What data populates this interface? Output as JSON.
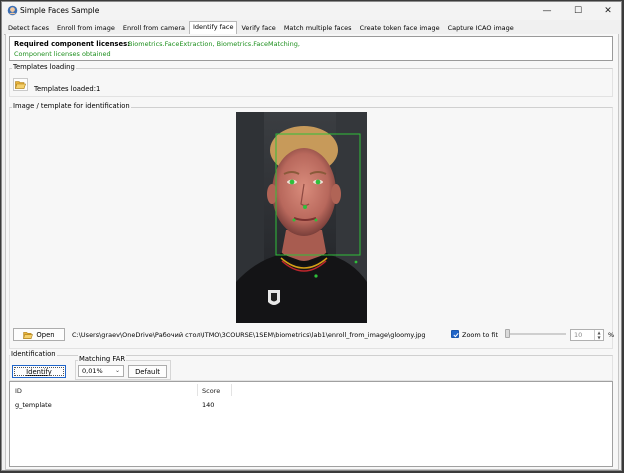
{
  "window": {
    "title": "Simple Faces Sample",
    "controls": {
      "minimize": "—",
      "maximize": "☐",
      "close": "✕"
    }
  },
  "tabs": [
    {
      "label": "Detect faces",
      "active": false
    },
    {
      "label": "Enroll from image",
      "active": false
    },
    {
      "label": "Enroll from camera",
      "active": false
    },
    {
      "label": "Identify face",
      "active": true
    },
    {
      "label": "Verify face",
      "active": false
    },
    {
      "label": "Match multiple faces",
      "active": false
    },
    {
      "label": "Create token face image",
      "active": false
    },
    {
      "label": "Capture ICAO image",
      "active": false
    }
  ],
  "licenses": {
    "label": "Required component licenses:",
    "list": "Biometrics.FaceExtraction, Biometrics.FaceMatching,",
    "status": "Component licenses obtained",
    "status_color": "#1d8f1d"
  },
  "templates": {
    "group_title": "Templates loading",
    "loaded_label": "Templates loaded:",
    "loaded_count": "1",
    "open_icon": "folder-open-icon"
  },
  "image_group": {
    "title": "Image / template for identification",
    "open_label": "Open",
    "file_path": "C:\\Users\\graev\\OneDrive\\Рабочий стол\\ITMO\\3COURSE\\1SEM\\biometrics\\lab1\\enroll_from_image\\gloomy.jpg",
    "zoom_to_fit_label": "Zoom to fit",
    "zoom_to_fit_checked": true,
    "zoom_value": "10",
    "percent_sign": "%"
  },
  "identification": {
    "group_title": "Identification",
    "identify_label": "Identify",
    "matching_far_title": "Matching FAR",
    "far_value": "0,01%",
    "default_label": "Default"
  },
  "results": {
    "columns": [
      "ID",
      "Score"
    ],
    "rows": [
      {
        "id": "g_template",
        "score": "140"
      }
    ]
  },
  "colors": {
    "accent": "#2065c9",
    "overlay": "#2fbf3a"
  }
}
